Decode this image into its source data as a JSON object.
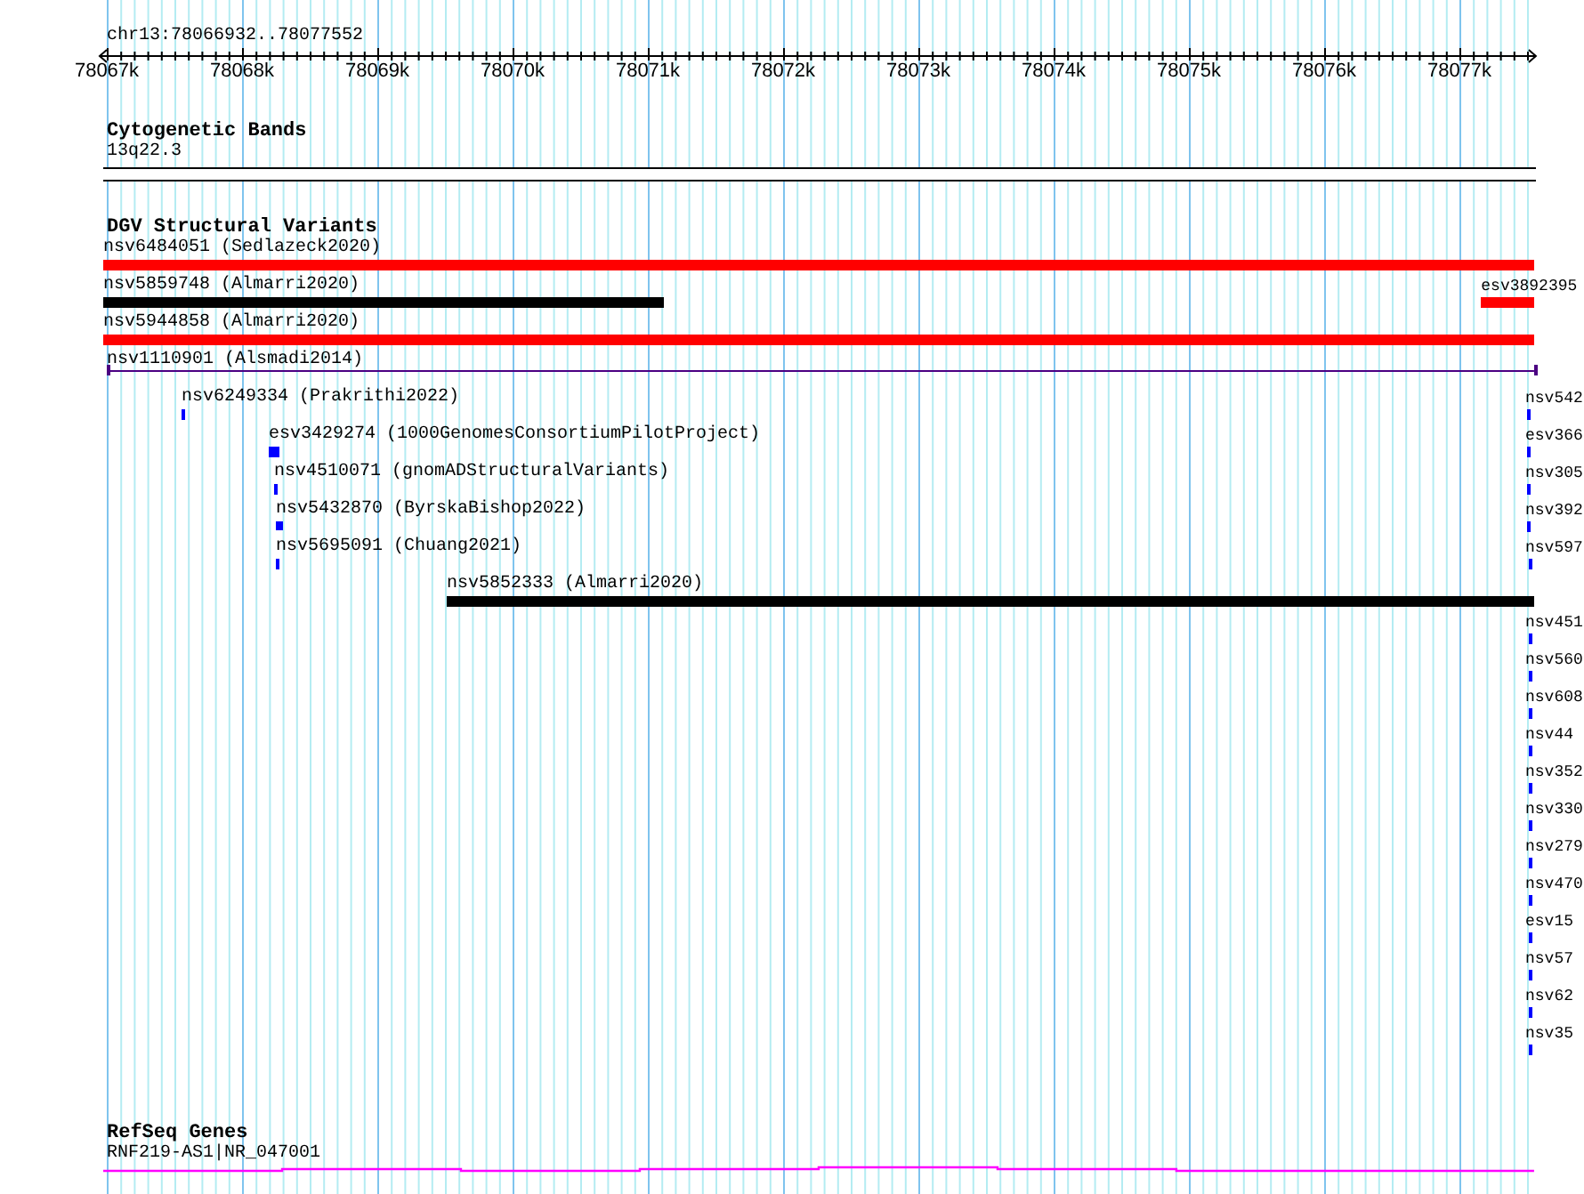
{
  "ruler": {
    "location": "chr13:78066932..78077552",
    "ticks": [
      "78067k",
      "78068k",
      "78069k",
      "78070k",
      "78071k",
      "78072k",
      "78073k",
      "78074k",
      "78075k",
      "78076k",
      "78077k"
    ]
  },
  "tracks": [
    {
      "kind": "bands",
      "title": "Cytogenetic Bands",
      "features": [
        {
          "label": "13q22.3"
        }
      ]
    },
    {
      "kind": "variants",
      "title": "DGV Structural Variants",
      "rows": [
        [
          {
            "label": "nsv6484051 (Sedlazeck2020)",
            "kind": "bar",
            "color": "#ff0000"
          }
        ],
        [
          {
            "label": "nsv5859748 (Almarri2020)",
            "kind": "bar",
            "color": "#000000"
          },
          {
            "label": "esv3892395",
            "kind": "bar",
            "color": "#ff0000"
          }
        ],
        [
          {
            "label": "nsv5944858 (Almarri2020)",
            "kind": "bar",
            "color": "#ff0000"
          }
        ],
        [
          {
            "label": "nsv1110901 (Alsmadi2014)",
            "kind": "line",
            "color": "#4b0082"
          }
        ],
        [
          {
            "label": "nsv6249334 (Prakrithi2022)",
            "kind": "tick",
            "color": "#0000ff"
          },
          {
            "label": "nsv542",
            "kind": "tick",
            "color": "#0000ff"
          }
        ],
        [
          {
            "label": "esv3429274 (1000GenomesConsortiumPilotProject)",
            "kind": "bar",
            "color": "#0000ff"
          },
          {
            "label": "esv366",
            "kind": "tick",
            "color": "#0000ff"
          }
        ],
        [
          {
            "label": "nsv4510071 (gnomADStructuralVariants)",
            "kind": "tick",
            "color": "#0000ff"
          },
          {
            "label": "nsv305",
            "kind": "tick",
            "color": "#0000ff"
          }
        ],
        [
          {
            "label": "nsv5432870 (ByrskaBishop2022)",
            "kind": "bar",
            "color": "#0000ff"
          },
          {
            "label": "nsv392",
            "kind": "tick",
            "color": "#0000ff"
          }
        ],
        [
          {
            "label": "nsv5695091 (Chuang2021)",
            "kind": "tick",
            "color": "#0000ff"
          },
          {
            "label": "nsv597",
            "kind": "tick",
            "color": "#0000ff"
          }
        ],
        [
          {
            "label": "nsv5852333 (Almarri2020)",
            "kind": "bar",
            "color": "#000000"
          }
        ],
        [
          {
            "label": "nsv451",
            "kind": "tick",
            "color": "#0000ff"
          }
        ],
        [
          {
            "label": "nsv560",
            "kind": "tick",
            "color": "#0000ff"
          }
        ],
        [
          {
            "label": "nsv608",
            "kind": "tick",
            "color": "#0000ff"
          }
        ],
        [
          {
            "label": "nsv44",
            "kind": "tick",
            "color": "#0000ff"
          }
        ],
        [
          {
            "label": "nsv352",
            "kind": "tick",
            "color": "#0000ff"
          }
        ],
        [
          {
            "label": "nsv330",
            "kind": "tick",
            "color": "#0000ff"
          }
        ],
        [
          {
            "label": "nsv279",
            "kind": "tick",
            "color": "#0000ff"
          }
        ],
        [
          {
            "label": "nsv470",
            "kind": "tick",
            "color": "#0000ff"
          }
        ],
        [
          {
            "label": "esv15",
            "kind": "tick",
            "color": "#0000ff"
          }
        ],
        [
          {
            "label": "nsv57",
            "kind": "tick",
            "color": "#0000ff"
          }
        ],
        [
          {
            "label": "nsv62",
            "kind": "tick",
            "color": "#0000ff"
          }
        ],
        [
          {
            "label": "nsv35",
            "kind": "tick",
            "color": "#0000ff"
          }
        ]
      ]
    },
    {
      "kind": "genes",
      "title": "RefSeq Genes",
      "features": [
        {
          "label": "RNF219-AS1|NR_047001"
        }
      ]
    }
  ]
}
